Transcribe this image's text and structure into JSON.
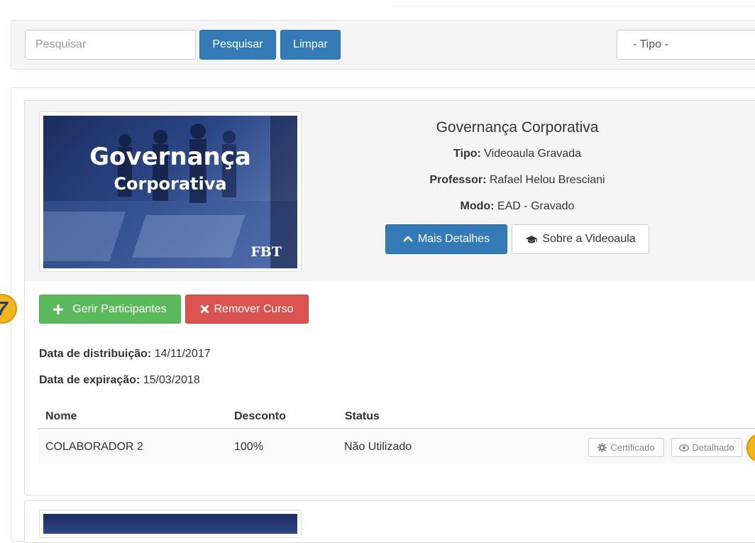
{
  "search": {
    "placeholder": "Pesquisar",
    "value": "",
    "search_button": "Pesquisar",
    "clear_button": "Limpar",
    "type_select": "- Tipo -"
  },
  "course": {
    "thumbnail": {
      "line1": "Governança",
      "line2": "Corporativa",
      "brand": "FBT"
    },
    "title": "Governança Corporativa",
    "type_label": "Tipo:",
    "type_value": " Videoaula Gravada",
    "professor_label": "Professor:",
    "professor_value": " Rafael Helou Bresciani",
    "mode_label": "Modo:",
    "mode_value": " EAD - Gravado",
    "more_details_button": "Mais Detalhes",
    "about_button": "Sobre a Videoaula",
    "manage_participants_button": "Gerir Participantes",
    "remove_course_button": "Remover Curso",
    "distribution_label": "Data de distribuição:",
    "distribution_date": " 14/11/2017",
    "expiration_label": "Data de expiração:",
    "expiration_date": " 15/03/2018",
    "table": {
      "headers": [
        "Nome",
        "Desconto",
        "Status"
      ],
      "rows": [
        {
          "name": "COLABORADOR 2",
          "discount": "100%",
          "status": "Não Utilizado",
          "certificate_button": "Certificado",
          "detailed_button": "Detalhado"
        }
      ]
    }
  },
  "step_badge": "7",
  "colors": {
    "primary": "#337ab7",
    "success": "#5cb85c",
    "danger": "#d9534f",
    "badge": "#f2b51c"
  }
}
